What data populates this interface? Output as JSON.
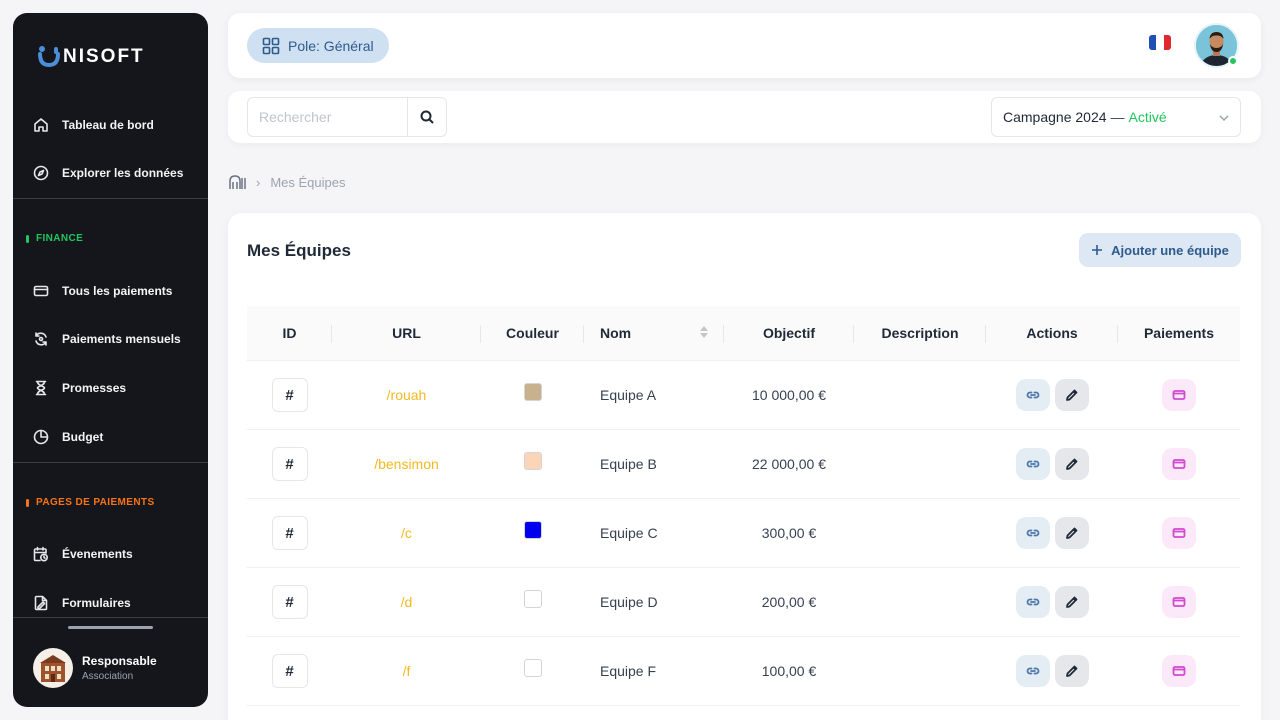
{
  "app": {
    "logo_text": "NISOFT"
  },
  "sidebar": {
    "nav": [
      {
        "label": "Tableau de bord",
        "icon": "home-icon"
      },
      {
        "label": "Explorer les données",
        "icon": "compass-icon"
      }
    ],
    "finance": {
      "title": "FINANCE",
      "color": "#22c55e",
      "items": [
        {
          "label": "Tous les paiements",
          "icon": "credit-card-icon"
        },
        {
          "label": "Paiements mensuels",
          "icon": "refresh-icon"
        },
        {
          "label": "Promesses",
          "icon": "hourglass-icon"
        },
        {
          "label": "Budget",
          "icon": "pie-chart-icon"
        }
      ]
    },
    "pages": {
      "title": "PAGES DE PAIEMENTS",
      "color": "#f97316",
      "items": [
        {
          "label": "Évenements",
          "icon": "calendar-clock-icon"
        },
        {
          "label": "Formulaires",
          "icon": "file-form-icon"
        }
      ]
    },
    "user": {
      "name": "Responsable",
      "role": "Association"
    }
  },
  "topbar": {
    "pole_label": "Pole: Général"
  },
  "search": {
    "placeholder": "Rechercher",
    "value": ""
  },
  "campaign": {
    "name": "Campagne 2024",
    "separator": "—",
    "status": "Activé"
  },
  "breadcrumb": {
    "current": "Mes Équipes"
  },
  "main": {
    "title": "Mes Équipes",
    "add_button": "Ajouter une équipe"
  },
  "table": {
    "headers": [
      "ID",
      "URL",
      "Couleur",
      "Nom",
      "Objectif",
      "Description",
      "Actions",
      "Paiements"
    ],
    "rows": [
      {
        "id": "#",
        "url": "/rouah",
        "color": "#c8b28e",
        "name": "Equipe A",
        "objective": "10 000,00 €",
        "description": ""
      },
      {
        "id": "#",
        "url": "/bensimon",
        "color": "#fbd5b5",
        "name": "Equipe B",
        "objective": "22 000,00 €",
        "description": ""
      },
      {
        "id": "#",
        "url": "/c",
        "color": "#0000ee",
        "name": "Equipe C",
        "objective": "300,00 €",
        "description": ""
      },
      {
        "id": "#",
        "url": "/d",
        "color": "#ffffff",
        "name": "Equipe D",
        "objective": "200,00 €",
        "description": ""
      },
      {
        "id": "#",
        "url": "/f",
        "color": "#ffffff",
        "name": "Equipe F",
        "objective": "100,00 €",
        "description": ""
      }
    ]
  },
  "colors": {
    "accent": "#2d5b8c",
    "url": "#f3b91f",
    "sidebar_bg": "#14161b"
  }
}
